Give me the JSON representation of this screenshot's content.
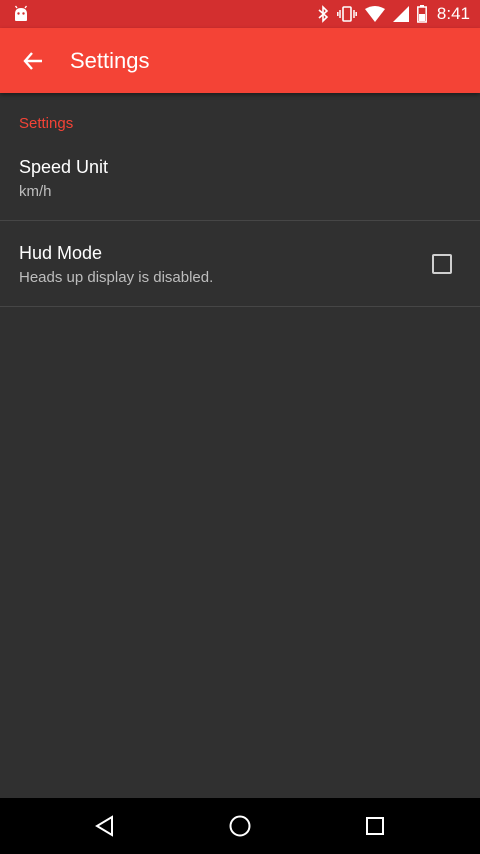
{
  "status_bar": {
    "time": "8:41",
    "icons": [
      "android-icon",
      "bluetooth-icon",
      "vibrate-icon",
      "wifi-icon",
      "signal-icon",
      "battery-icon"
    ],
    "color": "#d32f2f"
  },
  "toolbar": {
    "title": "Settings",
    "back_icon": "arrow-left-icon",
    "color": "#f44336"
  },
  "settings": {
    "category": "Settings",
    "items": [
      {
        "title": "Speed Unit",
        "summary": "km/h"
      },
      {
        "title": "Hud Mode",
        "summary": "Heads up display is disabled.",
        "checked": false
      }
    ]
  },
  "nav_bar": {
    "icons": [
      "back-triangle-icon",
      "home-circle-icon",
      "recents-square-icon"
    ]
  }
}
